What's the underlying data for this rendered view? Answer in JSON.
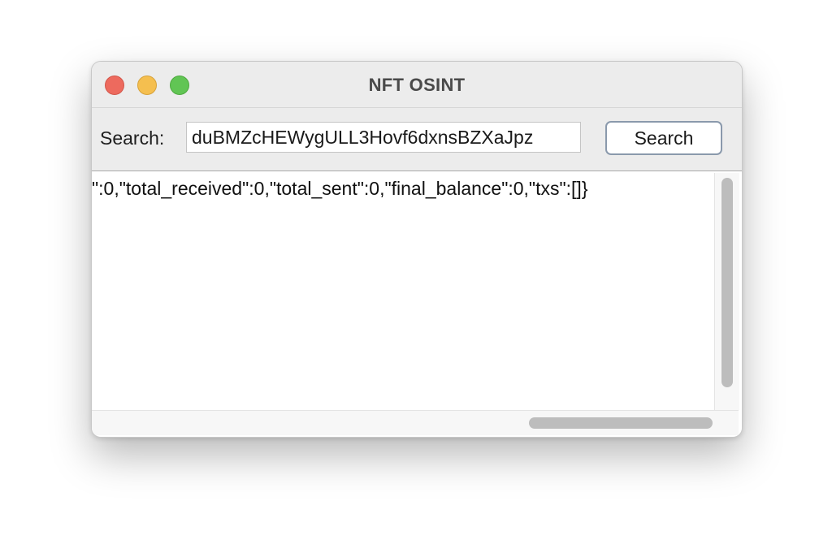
{
  "window": {
    "title": "NFT OSINT"
  },
  "toolbar": {
    "search_label": "Search:",
    "search_value": "duBMZcHEWygULL3Hovf6dxnsBZXaJpz",
    "search_button_label": "Search"
  },
  "results": {
    "text": "\":0,\"total_received\":0,\"total_sent\":0,\"final_balance\":0,\"txs\":[]}"
  }
}
